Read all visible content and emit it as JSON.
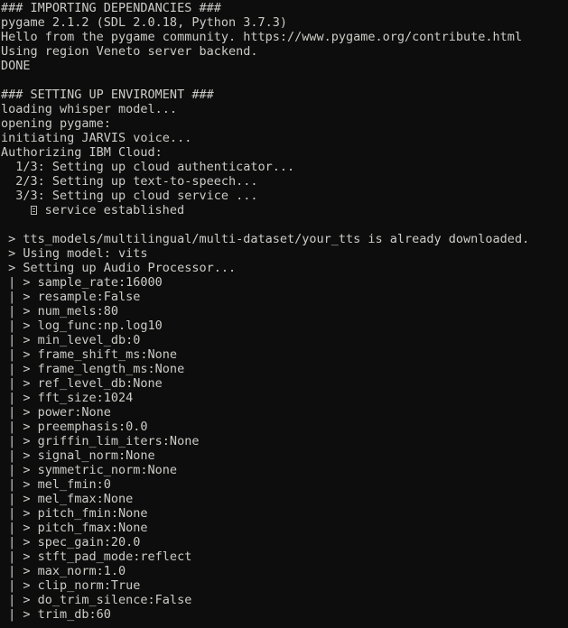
{
  "terminal": {
    "background_color": "#0d0d0d",
    "foreground_color": "#ccccc7",
    "lines": [
      {
        "id": "line-01",
        "text": "### IMPORTING DEPENDANCIES ###"
      },
      {
        "id": "line-02",
        "text": "pygame 2.1.2 (SDL 2.0.18, Python 3.7.3)"
      },
      {
        "id": "line-03",
        "text": "Hello from the pygame community. https://www.pygame.org/contribute.html"
      },
      {
        "id": "line-04",
        "text": "Using region Veneto server backend."
      },
      {
        "id": "line-05",
        "text": "DONE"
      },
      {
        "id": "line-06",
        "text": ""
      },
      {
        "id": "line-07",
        "text": "### SETTING UP ENVIROMENT ###"
      },
      {
        "id": "line-08",
        "text": "loading whisper model..."
      },
      {
        "id": "line-09",
        "text": "opening pygame:"
      },
      {
        "id": "line-10",
        "text": "initiating JARVIS voice..."
      },
      {
        "id": "line-11",
        "text": "Authorizing IBM Cloud:"
      },
      {
        "id": "line-12",
        "text": "  1/3: Setting up cloud authenticator..."
      },
      {
        "id": "line-13",
        "text": "  2/3: Setting up text-to-speech..."
      },
      {
        "id": "line-14",
        "text": "  3/3: Setting up cloud service ..."
      },
      {
        "id": "line-15",
        "prefix": "    ",
        "glyph": "missing-glyph-box",
        "text": " service established"
      },
      {
        "id": "line-16",
        "text": ""
      },
      {
        "id": "line-17",
        "text": " > tts_models/multilingual/multi-dataset/your_tts is already downloaded."
      },
      {
        "id": "line-18",
        "text": " > Using model: vits"
      },
      {
        "id": "line-19",
        "text": " > Setting up Audio Processor..."
      },
      {
        "id": "line-20",
        "text": " | > sample_rate:16000"
      },
      {
        "id": "line-21",
        "text": " | > resample:False"
      },
      {
        "id": "line-22",
        "text": " | > num_mels:80"
      },
      {
        "id": "line-23",
        "text": " | > log_func:np.log10"
      },
      {
        "id": "line-24",
        "text": " | > min_level_db:0"
      },
      {
        "id": "line-25",
        "text": " | > frame_shift_ms:None"
      },
      {
        "id": "line-26",
        "text": " | > frame_length_ms:None"
      },
      {
        "id": "line-27",
        "text": " | > ref_level_db:None"
      },
      {
        "id": "line-28",
        "text": " | > fft_size:1024"
      },
      {
        "id": "line-29",
        "text": " | > power:None"
      },
      {
        "id": "line-30",
        "text": " | > preemphasis:0.0"
      },
      {
        "id": "line-31",
        "text": " | > griffin_lim_iters:None"
      },
      {
        "id": "line-32",
        "text": " | > signal_norm:None"
      },
      {
        "id": "line-33",
        "text": " | > symmetric_norm:None"
      },
      {
        "id": "line-34",
        "text": " | > mel_fmin:0"
      },
      {
        "id": "line-35",
        "text": " | > mel_fmax:None"
      },
      {
        "id": "line-36",
        "text": " | > pitch_fmin:None"
      },
      {
        "id": "line-37",
        "text": " | > pitch_fmax:None"
      },
      {
        "id": "line-38",
        "text": " | > spec_gain:20.0"
      },
      {
        "id": "line-39",
        "text": " | > stft_pad_mode:reflect"
      },
      {
        "id": "line-40",
        "text": " | > max_norm:1.0"
      },
      {
        "id": "line-41",
        "text": " | > clip_norm:True"
      },
      {
        "id": "line-42",
        "text": " | > do_trim_silence:False"
      },
      {
        "id": "line-43",
        "text": " | > trim_db:60"
      }
    ]
  }
}
